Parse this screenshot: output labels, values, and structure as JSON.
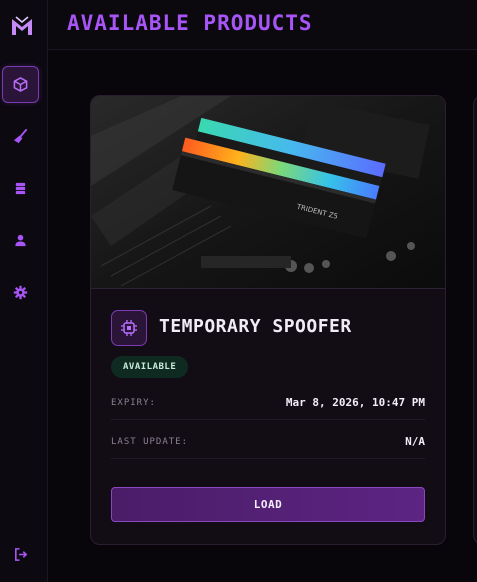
{
  "header": {
    "title": "AVAILABLE PRODUCTS"
  },
  "sidebar": {
    "logo": "logo-icon",
    "items": [
      {
        "name": "products",
        "icon": "cube-icon",
        "active": true
      },
      {
        "name": "cleaner",
        "icon": "broom-icon",
        "active": false
      },
      {
        "name": "storage",
        "icon": "database-icon",
        "active": false
      },
      {
        "name": "account",
        "icon": "user-icon",
        "active": false
      },
      {
        "name": "settings",
        "icon": "gear-icon",
        "active": false
      }
    ],
    "logout": "logout-icon"
  },
  "product": {
    "title": "TEMPORARY SPOOFER",
    "status": "AVAILABLE",
    "icon": "chip-icon",
    "expiry_label": "EXPIRY:",
    "expiry_value": "Mar 8, 2026, 10:47 PM",
    "update_label": "LAST UPDATE:",
    "update_value": "N/A",
    "load_label": "LOAD"
  },
  "colors": {
    "accent": "#a855f7",
    "accent_dark": "#2a1539",
    "badge_bg": "#0f2a21",
    "background": "#0a070d"
  }
}
